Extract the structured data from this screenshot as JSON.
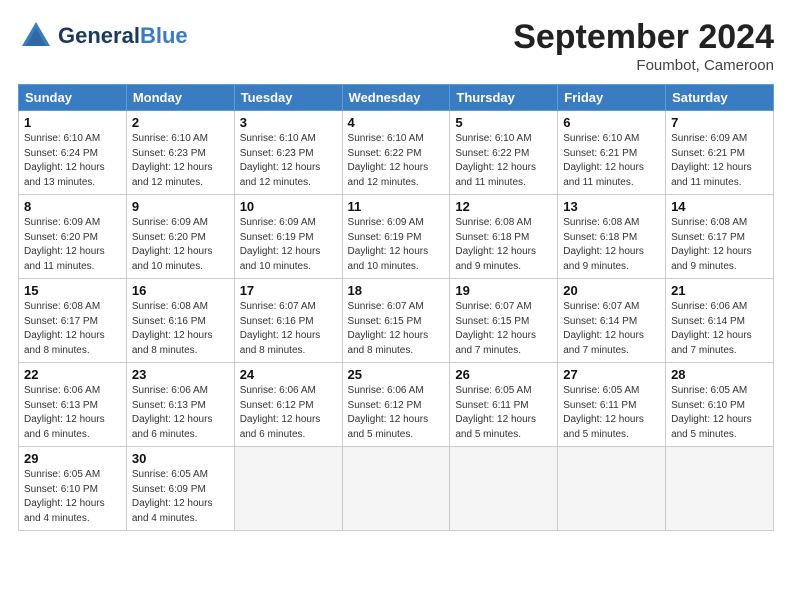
{
  "header": {
    "logo_general": "General",
    "logo_blue": "Blue",
    "month_title": "September 2024",
    "location": "Foumbot, Cameroon"
  },
  "days_of_week": [
    "Sunday",
    "Monday",
    "Tuesday",
    "Wednesday",
    "Thursday",
    "Friday",
    "Saturday"
  ],
  "weeks": [
    [
      {
        "day": "1",
        "info": "Sunrise: 6:10 AM\nSunset: 6:24 PM\nDaylight: 12 hours\nand 13 minutes."
      },
      {
        "day": "2",
        "info": "Sunrise: 6:10 AM\nSunset: 6:23 PM\nDaylight: 12 hours\nand 12 minutes."
      },
      {
        "day": "3",
        "info": "Sunrise: 6:10 AM\nSunset: 6:23 PM\nDaylight: 12 hours\nand 12 minutes."
      },
      {
        "day": "4",
        "info": "Sunrise: 6:10 AM\nSunset: 6:22 PM\nDaylight: 12 hours\nand 12 minutes."
      },
      {
        "day": "5",
        "info": "Sunrise: 6:10 AM\nSunset: 6:22 PM\nDaylight: 12 hours\nand 11 minutes."
      },
      {
        "day": "6",
        "info": "Sunrise: 6:10 AM\nSunset: 6:21 PM\nDaylight: 12 hours\nand 11 minutes."
      },
      {
        "day": "7",
        "info": "Sunrise: 6:09 AM\nSunset: 6:21 PM\nDaylight: 12 hours\nand 11 minutes."
      }
    ],
    [
      {
        "day": "8",
        "info": "Sunrise: 6:09 AM\nSunset: 6:20 PM\nDaylight: 12 hours\nand 11 minutes."
      },
      {
        "day": "9",
        "info": "Sunrise: 6:09 AM\nSunset: 6:20 PM\nDaylight: 12 hours\nand 10 minutes."
      },
      {
        "day": "10",
        "info": "Sunrise: 6:09 AM\nSunset: 6:19 PM\nDaylight: 12 hours\nand 10 minutes."
      },
      {
        "day": "11",
        "info": "Sunrise: 6:09 AM\nSunset: 6:19 PM\nDaylight: 12 hours\nand 10 minutes."
      },
      {
        "day": "12",
        "info": "Sunrise: 6:08 AM\nSunset: 6:18 PM\nDaylight: 12 hours\nand 9 minutes."
      },
      {
        "day": "13",
        "info": "Sunrise: 6:08 AM\nSunset: 6:18 PM\nDaylight: 12 hours\nand 9 minutes."
      },
      {
        "day": "14",
        "info": "Sunrise: 6:08 AM\nSunset: 6:17 PM\nDaylight: 12 hours\nand 9 minutes."
      }
    ],
    [
      {
        "day": "15",
        "info": "Sunrise: 6:08 AM\nSunset: 6:17 PM\nDaylight: 12 hours\nand 8 minutes."
      },
      {
        "day": "16",
        "info": "Sunrise: 6:08 AM\nSunset: 6:16 PM\nDaylight: 12 hours\nand 8 minutes."
      },
      {
        "day": "17",
        "info": "Sunrise: 6:07 AM\nSunset: 6:16 PM\nDaylight: 12 hours\nand 8 minutes."
      },
      {
        "day": "18",
        "info": "Sunrise: 6:07 AM\nSunset: 6:15 PM\nDaylight: 12 hours\nand 8 minutes."
      },
      {
        "day": "19",
        "info": "Sunrise: 6:07 AM\nSunset: 6:15 PM\nDaylight: 12 hours\nand 7 minutes."
      },
      {
        "day": "20",
        "info": "Sunrise: 6:07 AM\nSunset: 6:14 PM\nDaylight: 12 hours\nand 7 minutes."
      },
      {
        "day": "21",
        "info": "Sunrise: 6:06 AM\nSunset: 6:14 PM\nDaylight: 12 hours\nand 7 minutes."
      }
    ],
    [
      {
        "day": "22",
        "info": "Sunrise: 6:06 AM\nSunset: 6:13 PM\nDaylight: 12 hours\nand 6 minutes."
      },
      {
        "day": "23",
        "info": "Sunrise: 6:06 AM\nSunset: 6:13 PM\nDaylight: 12 hours\nand 6 minutes."
      },
      {
        "day": "24",
        "info": "Sunrise: 6:06 AM\nSunset: 6:12 PM\nDaylight: 12 hours\nand 6 minutes."
      },
      {
        "day": "25",
        "info": "Sunrise: 6:06 AM\nSunset: 6:12 PM\nDaylight: 12 hours\nand 5 minutes."
      },
      {
        "day": "26",
        "info": "Sunrise: 6:05 AM\nSunset: 6:11 PM\nDaylight: 12 hours\nand 5 minutes."
      },
      {
        "day": "27",
        "info": "Sunrise: 6:05 AM\nSunset: 6:11 PM\nDaylight: 12 hours\nand 5 minutes."
      },
      {
        "day": "28",
        "info": "Sunrise: 6:05 AM\nSunset: 6:10 PM\nDaylight: 12 hours\nand 5 minutes."
      }
    ],
    [
      {
        "day": "29",
        "info": "Sunrise: 6:05 AM\nSunset: 6:10 PM\nDaylight: 12 hours\nand 4 minutes."
      },
      {
        "day": "30",
        "info": "Sunrise: 6:05 AM\nSunset: 6:09 PM\nDaylight: 12 hours\nand 4 minutes."
      },
      {
        "day": "",
        "info": ""
      },
      {
        "day": "",
        "info": ""
      },
      {
        "day": "",
        "info": ""
      },
      {
        "day": "",
        "info": ""
      },
      {
        "day": "",
        "info": ""
      }
    ]
  ]
}
